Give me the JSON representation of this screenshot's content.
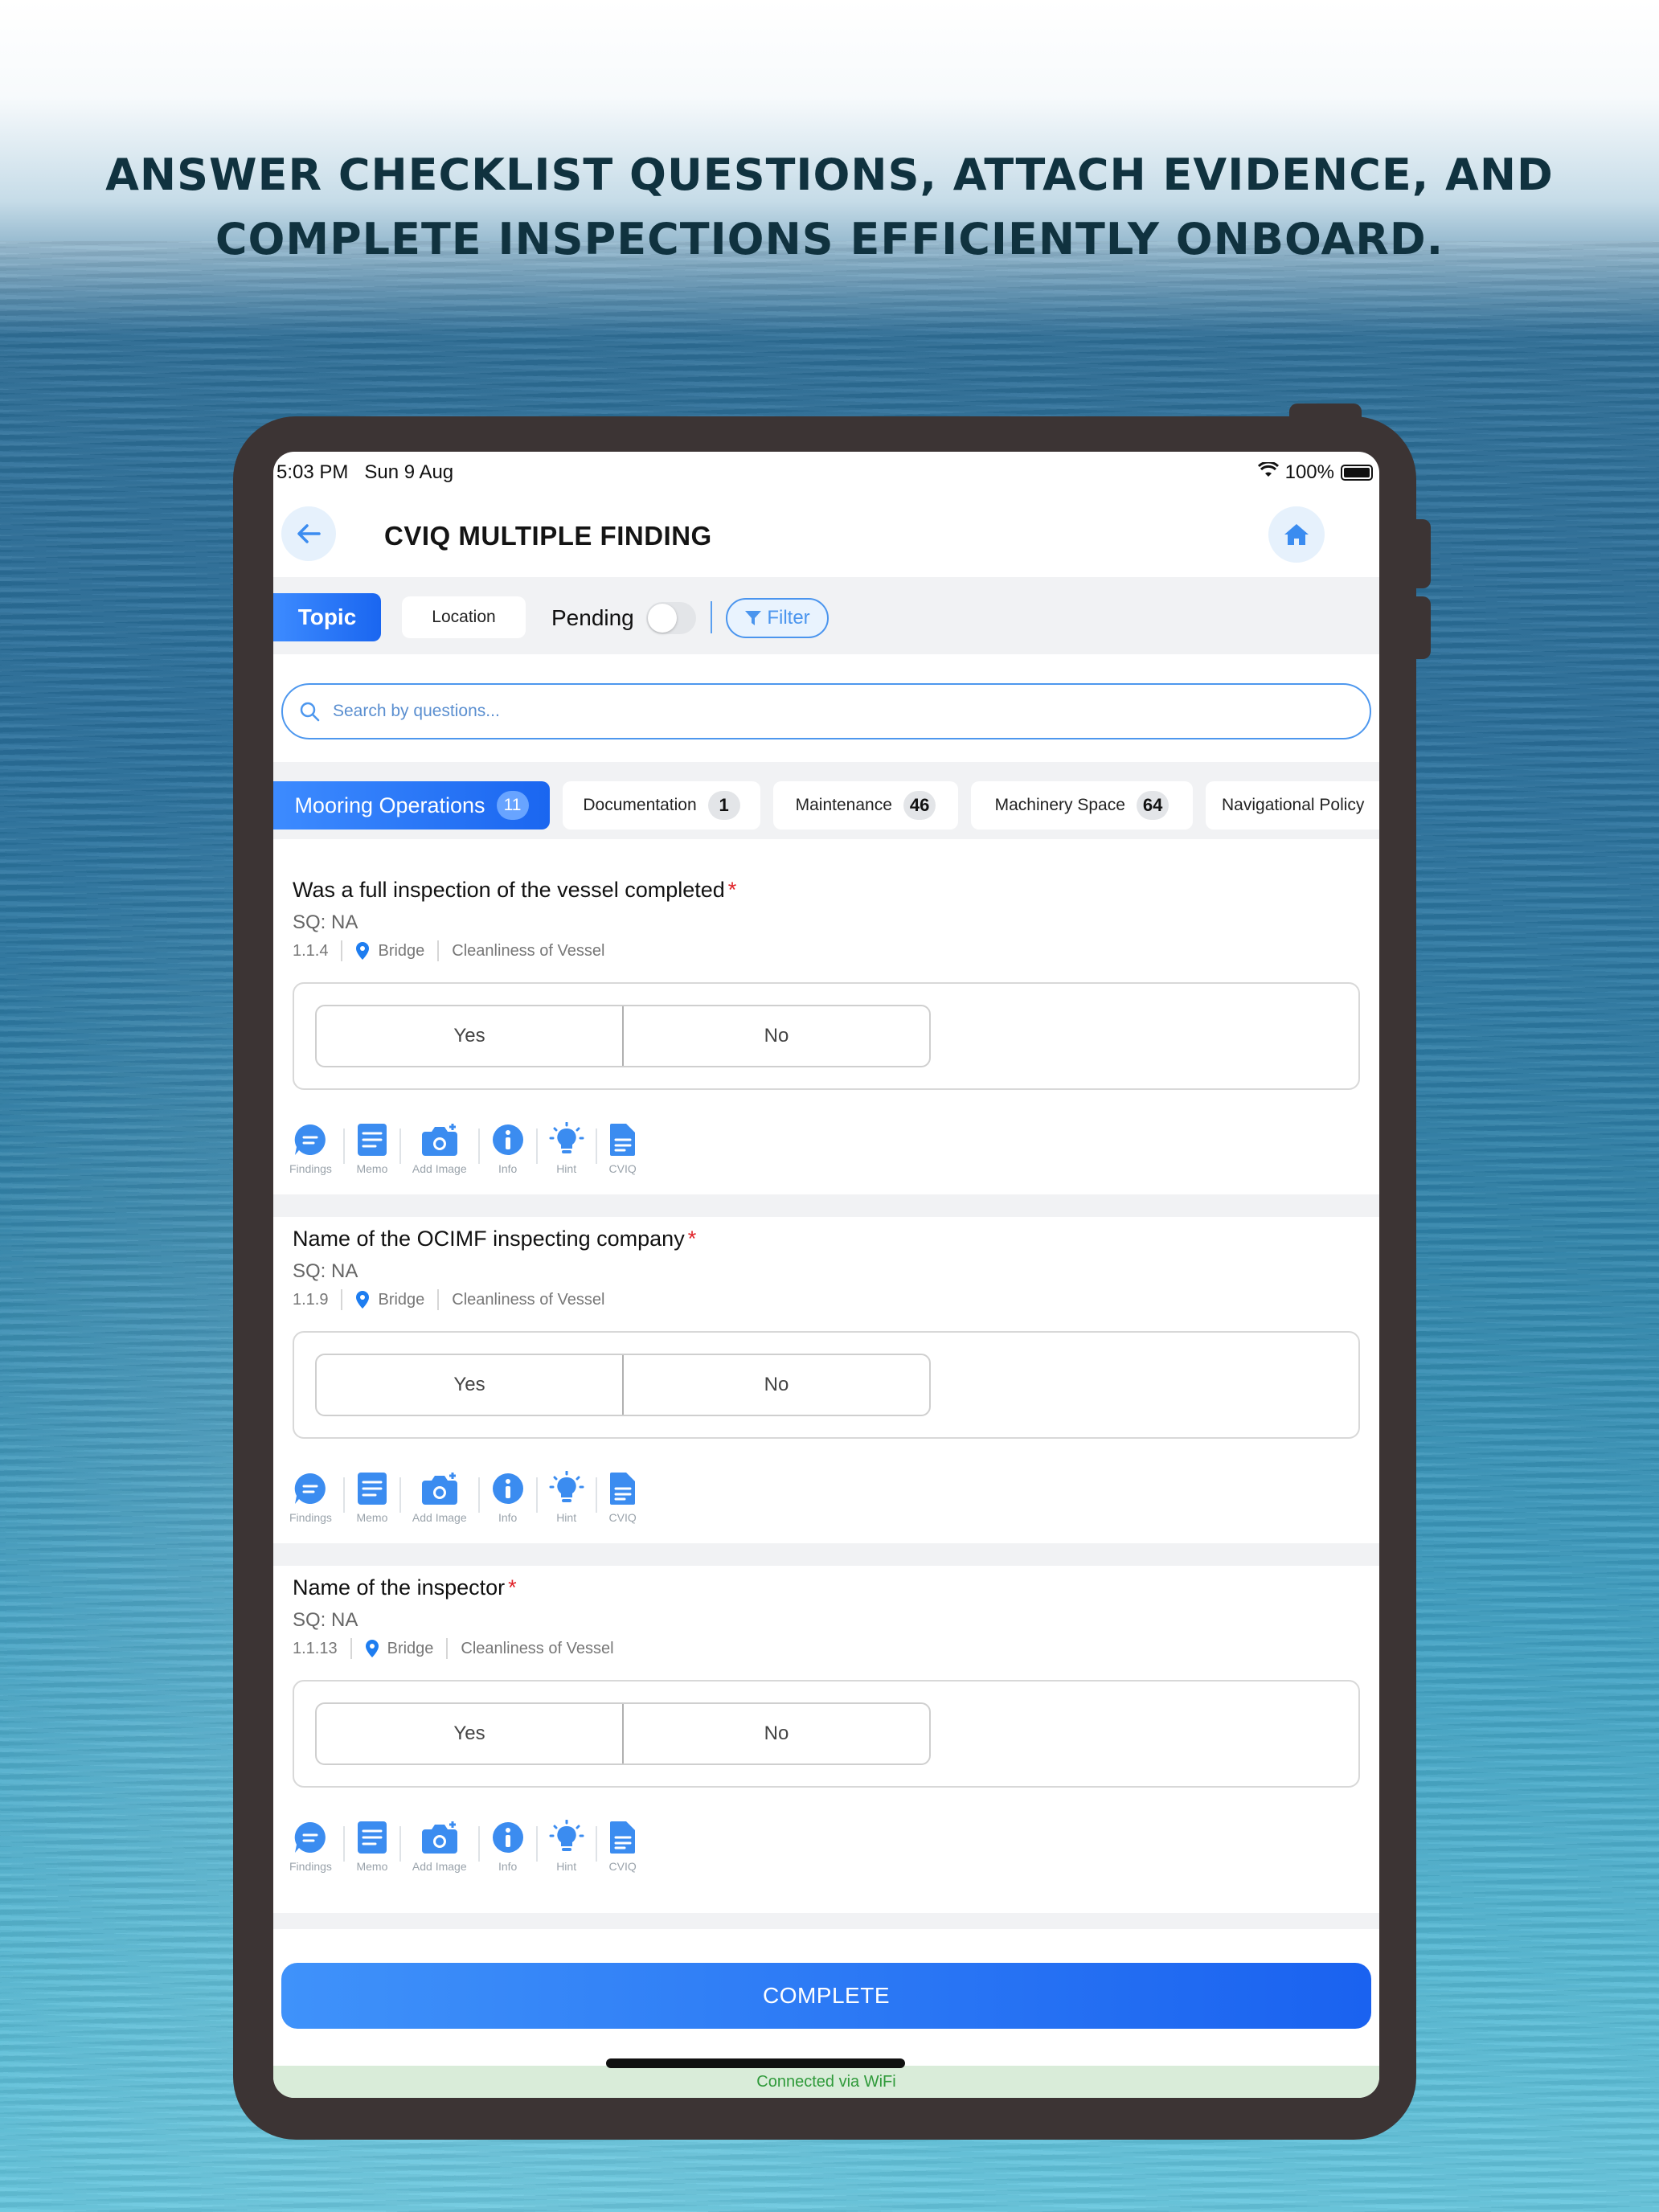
{
  "headline": {
    "line1": "ANSWER CHECKLIST QUESTIONS, ATTACH EVIDENCE, AND",
    "line2": "COMPLETE INSPECTIONS EFFICIENTLY ONBOARD."
  },
  "status_bar": {
    "time": "5:03 PM   Sun 9 Aug",
    "battery": "100%"
  },
  "header": {
    "title": "CVIQ MULTIPLE FINDING",
    "back_icon": "arrow-left-icon",
    "home_icon": "home-icon"
  },
  "filters": {
    "topic_label": "Topic",
    "location_label": "Location",
    "pending_label": "Pending",
    "pending_on": false,
    "filter_label": "Filter"
  },
  "search": {
    "placeholder": "Search by questions..."
  },
  "categories": [
    {
      "label": "Mooring Operations",
      "count": "11",
      "active": true
    },
    {
      "label": "Documentation",
      "count": "1"
    },
    {
      "label": "Maintenance",
      "count": "46"
    },
    {
      "label": "Machinery Space",
      "count": "64"
    },
    {
      "label": "Navigational Policy",
      "count": ""
    }
  ],
  "questions": [
    {
      "title": "Was a full inspection of the vessel completed",
      "required": "*",
      "sq": "SQ: NA",
      "code": "1.1.4",
      "location": "Bridge",
      "category": "Cleanliness of Vessel",
      "yes": "Yes",
      "no": "No"
    },
    {
      "title": "Name of the OCIMF inspecting company",
      "required": "*",
      "sq": "SQ: NA",
      "code": "1.1.9",
      "location": "Bridge",
      "category": "Cleanliness of Vessel",
      "yes": "Yes",
      "no": "No"
    },
    {
      "title": "Name of the inspector",
      "required": "*",
      "sq": "SQ: NA",
      "code": "1.1.13",
      "location": "Bridge",
      "category": "Cleanliness of Vessel",
      "yes": "Yes",
      "no": "No"
    }
  ],
  "actions": {
    "findings": "Findings",
    "memo": "Memo",
    "add_image": "Add Image",
    "info": "Info",
    "hint": "Hint",
    "cviq": "CVIQ"
  },
  "footer": {
    "complete_label": "COMPLETE",
    "connection": "Connected via WiFi"
  },
  "colors": {
    "accent": "#1a66f0",
    "headline": "#10323f",
    "device": "#3c3434",
    "required": "#e0242a",
    "wifi_text": "#2f9a3a"
  }
}
